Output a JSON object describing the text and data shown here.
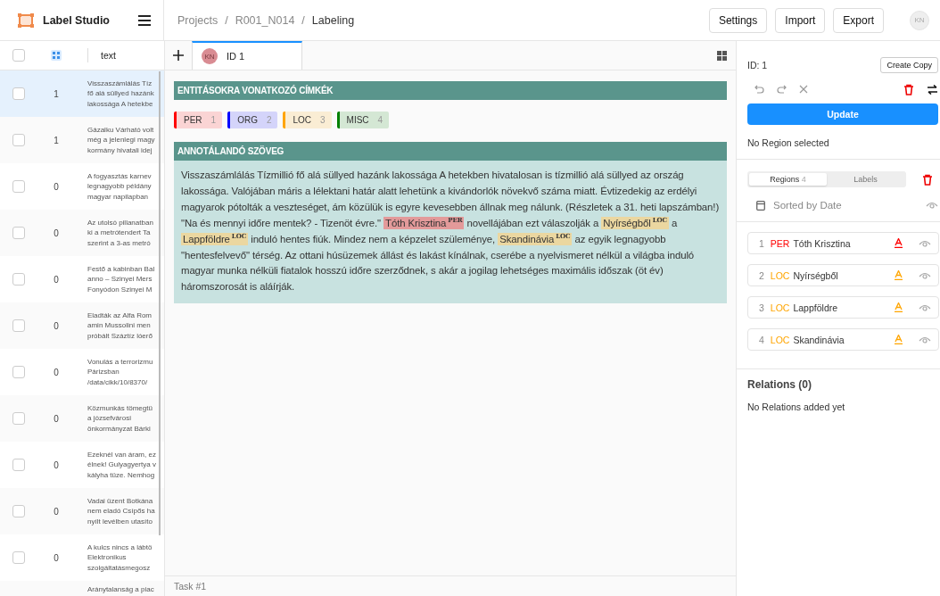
{
  "app": {
    "name": "Label Studio"
  },
  "breadcrumbs": [
    "Projects",
    "R001_N014",
    "Labeling"
  ],
  "breadcrumb_separators": [
    "/",
    "/"
  ],
  "header_buttons": [
    "Settings",
    "Import",
    "Export"
  ],
  "user_initials": "KN",
  "table": {
    "select_all_checked": false,
    "columns": [
      "text"
    ],
    "rows": [
      {
        "selected": true,
        "checked": false,
        "count": "1",
        "text": [
          "Visszaszámlálás Tíz",
          "fő alá süllyed hazánk",
          "lakossága A hetekbe"
        ]
      },
      {
        "selected": false,
        "checked": false,
        "count": "1",
        "text": [
          "Gázalku Várható volt",
          "még a jelenlegi magy",
          "kormány hivatali idej"
        ]
      },
      {
        "selected": false,
        "checked": false,
        "count": "0",
        "text": [
          "A fogyasztás karnev",
          "legnagyobb példány",
          "magyar napilapban"
        ]
      },
      {
        "selected": false,
        "checked": false,
        "count": "0",
        "text": [
          "Az utolsó pillanatban",
          "ki a metrótendert Ta",
          "szerint a 3-as metró"
        ]
      },
      {
        "selected": false,
        "checked": false,
        "count": "0",
        "text": [
          "Festő a kabinban Bal",
          "anno – Szinyei Mers",
          "Fonyódon Szinyei M"
        ]
      },
      {
        "selected": false,
        "checked": false,
        "count": "0",
        "text": [
          "Eladták az Alfa Rom",
          "amin Mussolini men",
          "próbált Száztíz lóerő"
        ]
      },
      {
        "selected": false,
        "checked": false,
        "count": "0",
        "text": [
          "Vonulás a terrorizmu",
          "Párizsban",
          "/data/cikk/10/8370/"
        ]
      },
      {
        "selected": false,
        "checked": false,
        "count": "0",
        "text": [
          "Közmunkás tömegtü",
          "a józsefvárosi",
          "önkormányzat Bárki"
        ]
      },
      {
        "selected": false,
        "checked": false,
        "count": "0",
        "text": [
          "Ezeknél van áram, ez",
          "élnek! Gulyagyertya v",
          "kályha tüze. Nemhog"
        ]
      },
      {
        "selected": false,
        "checked": false,
        "count": "0",
        "text": [
          "Vadai üzent Botkána",
          "nem eladó Csípős ha",
          "nyílt levélben utasíto"
        ]
      },
      {
        "selected": false,
        "checked": false,
        "count": "0",
        "text": [
          "A kulcs nincs a lábtö",
          "Elektronikus",
          "szolgáltatásmegosz"
        ]
      },
      {
        "selected": false,
        "text": [
          "Aránytalanság a piac"
        ]
      }
    ]
  },
  "annotation_tab": {
    "initials": "KN",
    "label": "ID 1",
    "selected": true
  },
  "labels_header": "ENTITÁSOKRA VONATKOZÓ CÍMKÉK",
  "labels": [
    {
      "name": "PER",
      "hotkey": "1",
      "color": "#ff0000"
    },
    {
      "name": "ORG",
      "hotkey": "2",
      "color": "#0000ff"
    },
    {
      "name": "LOC",
      "hotkey": "3",
      "color": "#ffa500"
    },
    {
      "name": "MISC",
      "hotkey": "4",
      "color": "#008000"
    }
  ],
  "text_header": "ANNOTÁLANDÓ SZÖVEG",
  "text_segments": [
    {
      "text": "Visszaszámlálás Tízmillió fő alá süllyed hazánk lakossága A hetekben hivatalosan is tízmillió alá süllyed az ország lakossága. Valójában máris a lélektani határ alatt lehetünk a kivándorlók növekvő száma miatt. Évtizedekig az erdélyi magyarok pótolták a veszteséget, ám közülük is egyre kevesebben állnak meg nálunk. (Részletek a 31. heti lapszámban!) \"Na és mennyi időre mentek? - Tizenöt évre.\" "
    },
    {
      "text": "Tóth Krisztina",
      "tag": "PER",
      "color": "#e39a9a"
    },
    {
      "text": " novellájában ezt válaszolják a "
    },
    {
      "text": "Nyírségből",
      "tag": "LOC",
      "color": "#ebd7a0"
    },
    {
      "text": " a "
    },
    {
      "text": "Lappföldre",
      "tag": "LOC",
      "color": "#ebd7a0"
    },
    {
      "text": " induló hentes fiúk. Mindez nem a képzelet szüleménye, "
    },
    {
      "text": "Skandinávia",
      "tag": "LOC",
      "color": "#ebd7a0"
    },
    {
      "text": " az egyik legnagyobb \"hentesfelvevő\" térség. Az ottani húsüzemek állást és lakást kínálnak, cserébe a nyelvismeret nélkül a világba induló magyar munka nélküli fiatalok hosszú időre szerződnek, s akár a jogilag lehetséges maximális időszak (öt év) háromszorosát is aláírják."
    }
  ],
  "task_label": "Task #1",
  "side": {
    "id_label": "ID: 1",
    "create_copy": "Create Copy",
    "update": "Update",
    "no_region": "No Region selected",
    "tabs": [
      {
        "label": "Regions",
        "count": "4",
        "selected": true
      },
      {
        "label": "Labels",
        "selected": false
      }
    ],
    "sort_label": "Sorted by Date",
    "regions": [
      {
        "number": "1",
        "tag": "PER",
        "text": "Tóth Krisztina",
        "color": "#ff0000"
      },
      {
        "number": "2",
        "tag": "LOC",
        "text": "Nyírségből",
        "color": "#ffa500"
      },
      {
        "number": "3",
        "tag": "LOC",
        "text": "Lappföldre",
        "color": "#ffa500"
      },
      {
        "number": "4",
        "tag": "LOC",
        "text": "Skandinávia",
        "color": "#ffa500"
      }
    ],
    "relations_title": "Relations (0)",
    "relations_empty": "No Relations added yet"
  }
}
